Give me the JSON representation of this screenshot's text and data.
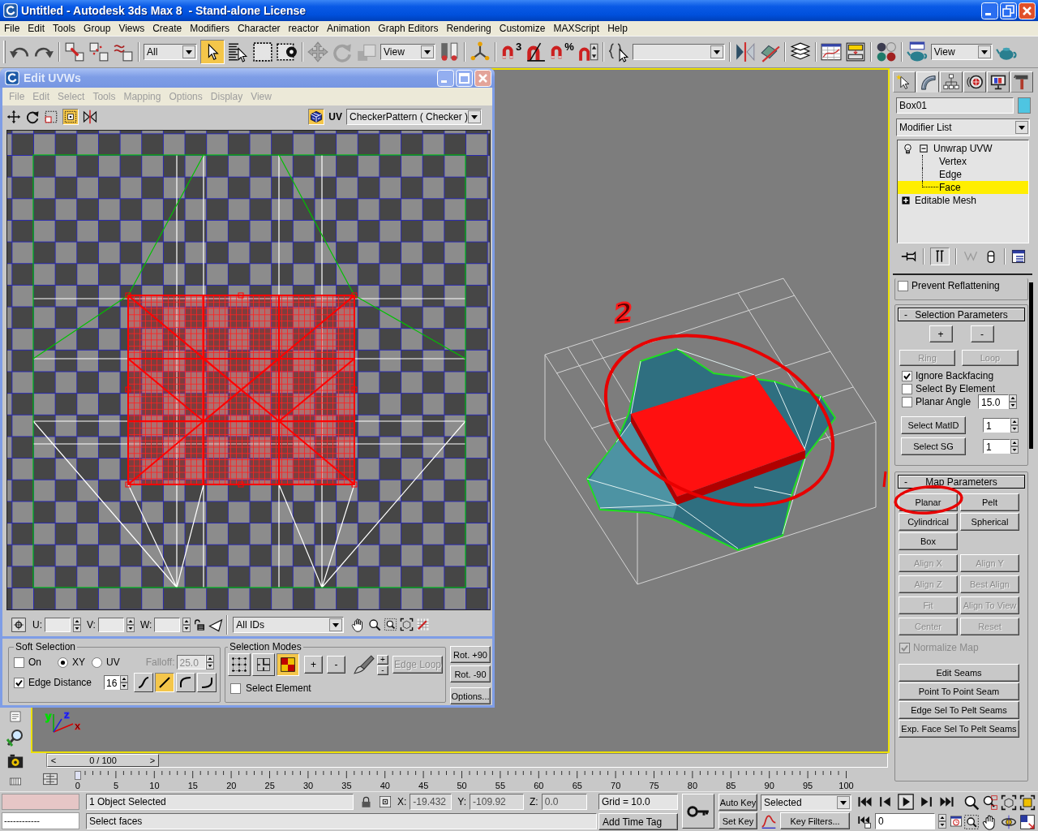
{
  "window": {
    "title": "Untitled - Autodesk 3ds Max 8  - Stand-alone License"
  },
  "menu": [
    "File",
    "Edit",
    "Tools",
    "Group",
    "Views",
    "Create",
    "Modifiers",
    "Character",
    "reactor",
    "Animation",
    "Graph Editors",
    "Rendering",
    "Customize",
    "MAXScript",
    "Help"
  ],
  "main_toolbar": {
    "selection_filter": "All",
    "select_object_on": true,
    "reference_coordinate_system": "View",
    "snap_dimension": "3",
    "percent_snap": "%",
    "render_type": "View"
  },
  "uv_editor": {
    "title": "Edit UVWs",
    "active": false,
    "menu": [
      "File",
      "Edit",
      "Select",
      "Tools",
      "Mapping",
      "Options",
      "Display",
      "View"
    ],
    "freeform_on": true,
    "show_map_on": true,
    "map_label": "UV",
    "texture": "CheckerPattern ( Checker )",
    "coordinates": [
      {
        "label": "U:"
      },
      {
        "label": "V:"
      },
      {
        "label": "W:"
      }
    ],
    "id_filter": "All IDs",
    "soft_selection": {
      "title": "Soft Selection",
      "on": {
        "label": "On",
        "checked": false
      },
      "spaces": [
        {
          "label": "XY",
          "selected": true
        },
        {
          "label": "UV",
          "selected": false
        }
      ],
      "falloff": {
        "label": "Falloff:",
        "value": "25.0",
        "disabled": true
      },
      "edge_distance": {
        "label": "Edge Distance",
        "checked": true,
        "value": "16"
      },
      "falloff_types": [
        {
          "selected": false
        },
        {
          "selected": true
        },
        {
          "selected": false
        },
        {
          "selected": false
        }
      ]
    },
    "selection_modes": {
      "title": "Selection Modes",
      "modes": [
        {
          "selected": false
        },
        {
          "selected": false
        },
        {
          "selected": true
        }
      ],
      "grow": "+",
      "shrink": "-",
      "paint_grow": "+",
      "paint_shrink": "-",
      "edge_loop": {
        "label": "Edge Loop",
        "disabled": true
      },
      "select_element": {
        "label": "Select Element",
        "checked": false
      }
    },
    "rotate": [
      "Rot. +90",
      "Rot. -90"
    ],
    "options": "Options..."
  },
  "viewport": {
    "annotation": "2",
    "axis_labels": [
      "y",
      "z",
      "x"
    ]
  },
  "command_panel": {
    "tabs": [
      {
        "selected": false
      },
      {
        "selected": true
      },
      {
        "selected": false
      },
      {
        "selected": false
      },
      {
        "selected": false
      },
      {
        "selected": false
      }
    ],
    "object_name": "Box01",
    "modifier_list": "Modifier List",
    "stack": [
      {
        "label": "Unwrap UVW",
        "kind": "modifier",
        "selected": false,
        "expanded": true,
        "children": [
          {
            "label": "Vertex",
            "selected": false
          },
          {
            "label": "Edge",
            "selected": false
          },
          {
            "label": "Face",
            "selected": true
          }
        ]
      },
      {
        "label": "Editable Mesh",
        "kind": "object",
        "selected": false,
        "expanded": false
      }
    ],
    "show_end_result": true,
    "prevent_reflattening": {
      "label": "Prevent Reflattening",
      "checked": false
    },
    "selection_parameters": {
      "title": "Selection Parameters",
      "sign": "-",
      "grow": "+",
      "shrink": "-",
      "ring": {
        "label": "Ring",
        "disabled": true
      },
      "loop": {
        "label": "Loop",
        "disabled": true
      },
      "options": [
        {
          "label": "Ignore Backfacing",
          "checked": true
        },
        {
          "label": "Select By Element",
          "checked": false
        },
        {
          "label": "Planar Angle",
          "checked": false,
          "value": "15.0"
        }
      ],
      "id_selects": [
        {
          "label": "Select MatID",
          "value": "1"
        },
        {
          "label": "Select SG",
          "value": "1"
        }
      ]
    },
    "map_parameters": {
      "title": "Map Parameters",
      "sign": "-",
      "projections": [
        [
          {
            "label": "Planar",
            "disabled": false
          },
          {
            "label": "Pelt",
            "disabled": false
          }
        ],
        [
          {
            "label": "Cylindrical",
            "disabled": false
          },
          {
            "label": "Spherical",
            "disabled": false
          }
        ],
        [
          {
            "label": "Box",
            "disabled": false
          }
        ]
      ],
      "alignment": [
        [
          {
            "label": "Align X",
            "disabled": true
          },
          {
            "label": "Align Y",
            "disabled": true
          }
        ],
        [
          {
            "label": "Align Z",
            "disabled": true
          },
          {
            "label": "Best Align",
            "disabled": true
          }
        ],
        [
          {
            "label": "Fit",
            "disabled": true
          },
          {
            "label": "Align To View",
            "disabled": true
          }
        ],
        [
          {
            "label": "Center",
            "disabled": true
          },
          {
            "label": "Reset",
            "disabled": true
          }
        ]
      ],
      "normalize": {
        "label": "Normalize Map",
        "checked": true,
        "disabled": true
      },
      "seams": [
        "Edit Seams",
        "Point To Point Seam",
        "Edge Sel To Pelt Seams",
        "Exp. Face Sel To Pelt Seams"
      ]
    }
  },
  "timeline": {
    "prev": "<",
    "position": "0 / 100",
    "next": ">",
    "level": 0,
    "ticks": [
      "0",
      "5",
      "10",
      "15",
      "20",
      "25",
      "30",
      "35",
      "40",
      "45",
      "50",
      "55",
      "60",
      "65",
      "70",
      "75",
      "80",
      "85",
      "90",
      "95",
      "100"
    ]
  },
  "status_bar": {
    "listener": "------------",
    "selection": "1 Object Selected",
    "prompt": "Select faces",
    "coordinates": [
      {
        "label": "X:",
        "value": "-19.432"
      },
      {
        "label": "Y:",
        "value": "-109.92"
      },
      {
        "label": "Z:",
        "value": "0.0"
      }
    ],
    "grid": "Grid = 10.0",
    "time_tag": "Add Time Tag",
    "auto_key": "Auto Key",
    "key_set": "Selected",
    "set_key": "Set Key",
    "key_filters": "Key Filters...",
    "frame": "0"
  }
}
